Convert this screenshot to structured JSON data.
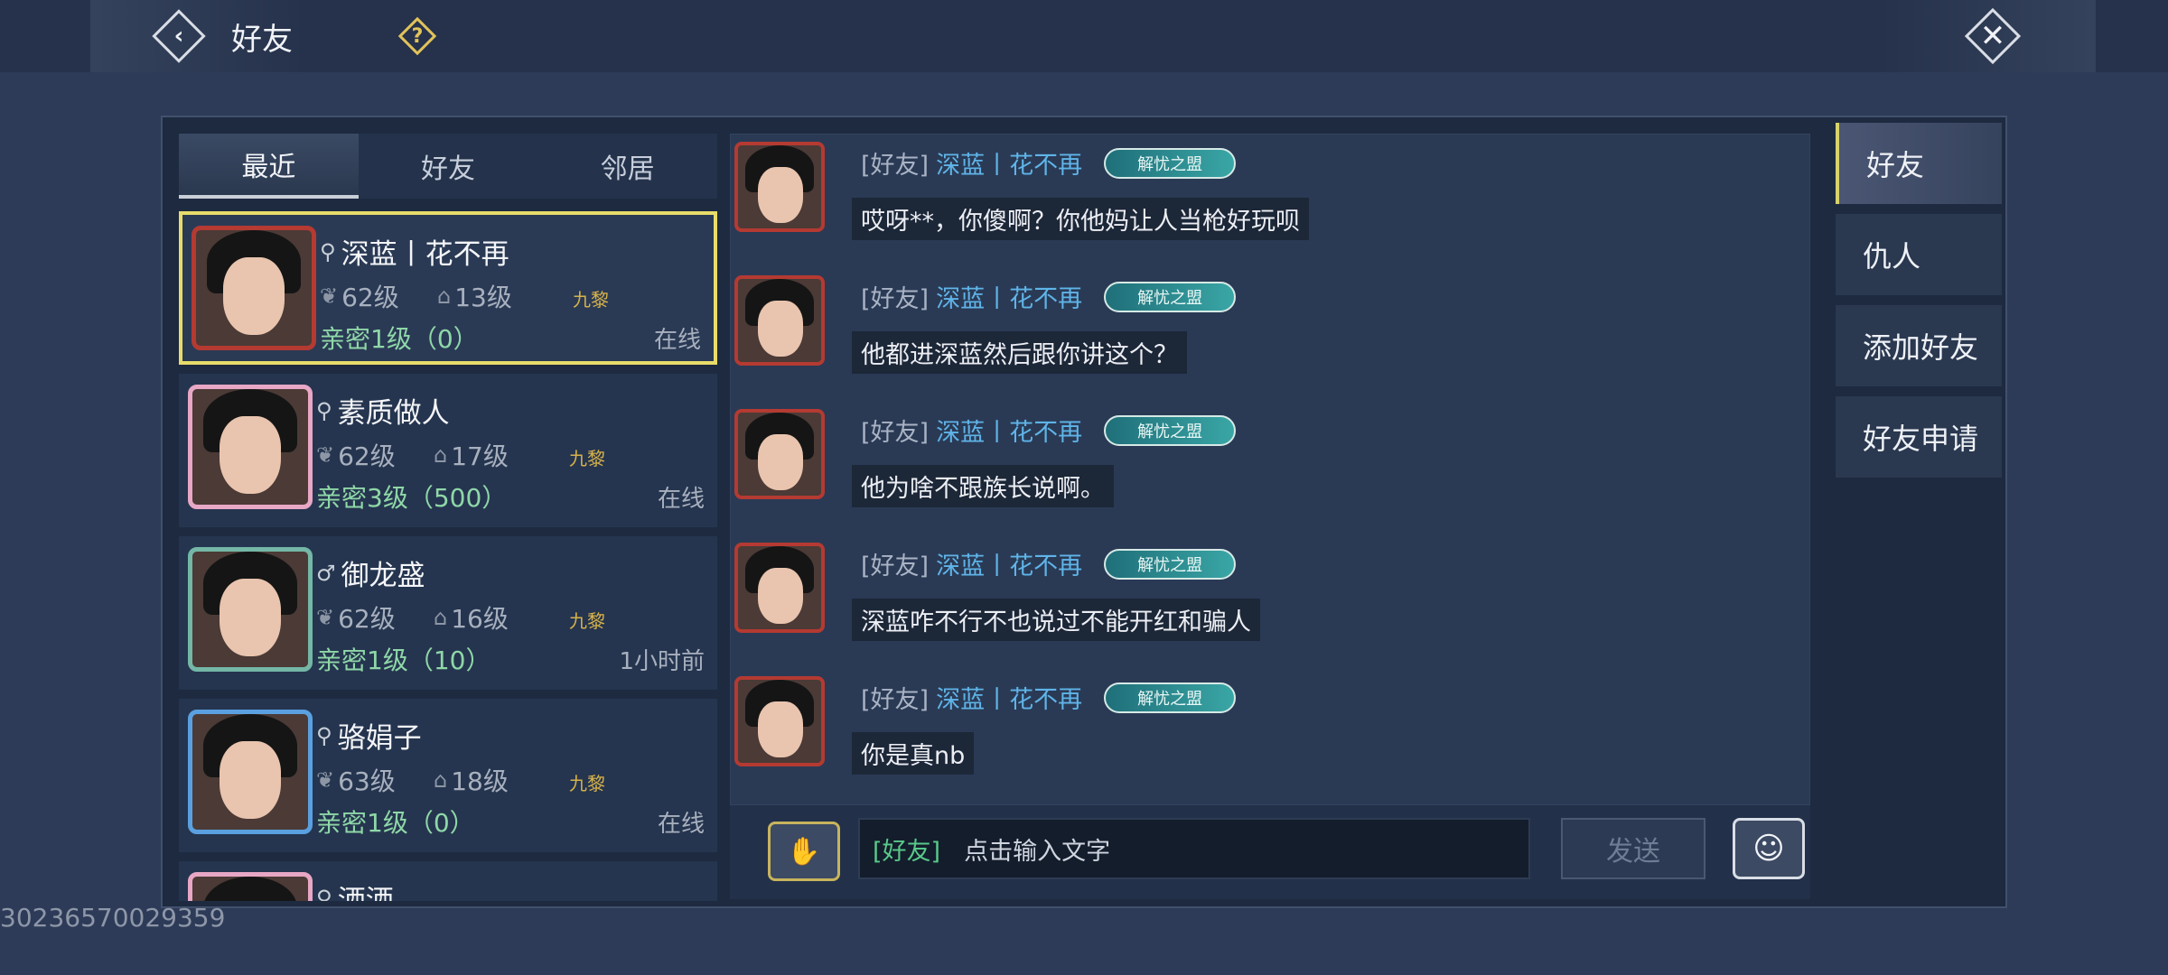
{
  "header": {
    "title": "好友",
    "back_icon": "back-arrow-icon",
    "help_icon": "help-icon",
    "close_icon": "close-icon"
  },
  "tabs": [
    {
      "label": "最近",
      "active": true
    },
    {
      "label": "好友",
      "active": false
    },
    {
      "label": "邻居",
      "active": false
    }
  ],
  "friends": [
    {
      "name": "深蓝丨花不再",
      "gender_icon": "⚲",
      "level": "62级",
      "level2": "13级",
      "badge": "九黎",
      "intimacy": "亲密1级（0）",
      "status": "在线",
      "selected": true
    },
    {
      "name": "素质做人",
      "gender_icon": "⚲",
      "level": "62级",
      "level2": "17级",
      "badge": "九黎",
      "intimacy": "亲密3级（500）",
      "status": "在线",
      "selected": false
    },
    {
      "name": "御龙盛",
      "gender_icon": "♂",
      "level": "62级",
      "level2": "16级",
      "badge": "九黎",
      "intimacy": "亲密1级（10）",
      "status": "1小时前",
      "selected": false
    },
    {
      "name": "骆娟子",
      "gender_icon": "⚲",
      "level": "63级",
      "level2": "18级",
      "badge": "九黎",
      "intimacy": "亲密1级（0）",
      "status": "在线",
      "selected": false
    },
    {
      "name": "洒洒",
      "gender_icon": "⚲",
      "level": "",
      "level2": "",
      "badge": "",
      "intimacy": "",
      "status": "",
      "selected": false
    }
  ],
  "messages": [
    {
      "channel": "[好友]",
      "sender": "深蓝丨花不再",
      "tag": "解忧之盟",
      "text": "哎呀**，你傻啊？你他妈让人当枪好玩呗"
    },
    {
      "channel": "[好友]",
      "sender": "深蓝丨花不再",
      "tag": "解忧之盟",
      "text": "他都进深蓝然后跟你讲这个？"
    },
    {
      "channel": "[好友]",
      "sender": "深蓝丨花不再",
      "tag": "解忧之盟",
      "text": "他为啥不跟族长说啊。"
    },
    {
      "channel": "[好友]",
      "sender": "深蓝丨花不再",
      "tag": "解忧之盟",
      "text": "深蓝咋不行不也说过不能开红和骗人"
    },
    {
      "channel": "[好友]",
      "sender": "深蓝丨花不再",
      "tag": "解忧之盟",
      "text": "你是真nb"
    }
  ],
  "input": {
    "channel": "[好友]",
    "placeholder": "点击输入文字",
    "send_label": "发送",
    "voice_icon": "microphone-icon",
    "emoji_icon": "emoji-icon"
  },
  "side_tabs": [
    {
      "label": "好友",
      "active": true
    },
    {
      "label": "仇人",
      "active": false
    },
    {
      "label": "添加好友",
      "active": false
    },
    {
      "label": "好友申请",
      "active": false
    }
  ],
  "watermark": "30236570029359"
}
